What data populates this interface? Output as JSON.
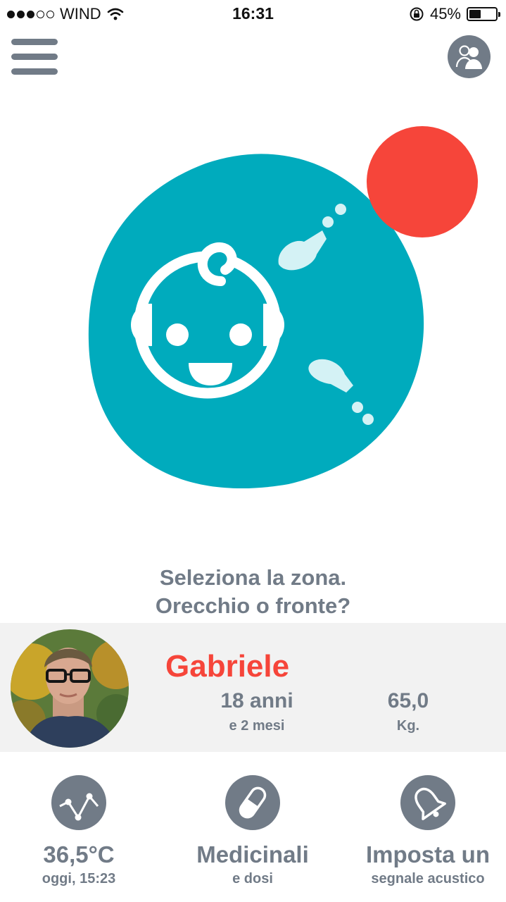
{
  "status_bar": {
    "carrier": "WIND",
    "time": "16:31",
    "battery_text": "45%",
    "battery_level": 0.45,
    "signal_bars_filled": 3,
    "signal_bars_total": 5
  },
  "header": {
    "menu_icon": "hamburger-menu-icon",
    "profiles_icon": "users-icon"
  },
  "zone_selector": {
    "colors": {
      "blob": "#00abbd",
      "dot": "#f6453a",
      "probe": "#d4f2f5"
    }
  },
  "instruction": {
    "line1": "Seleziona la zona.",
    "line2": "Orecchio o fronte?"
  },
  "profile": {
    "name": "Gabriele",
    "age_value": "18 anni",
    "age_sub": "e 2 mesi",
    "weight_value": "65,0",
    "weight_unit": "Kg."
  },
  "actions": [
    {
      "icon": "trend-chart-icon",
      "title": "36,5°C",
      "sub": "oggi, 15:23"
    },
    {
      "icon": "pill-icon",
      "title": "Medicinali",
      "sub": "e dosi"
    },
    {
      "icon": "bell-icon",
      "title": "Imposta un",
      "sub": "segnale acustico"
    }
  ],
  "colors": {
    "accent": "#f6453a",
    "text": "#717b87",
    "teal": "#00abbd"
  }
}
